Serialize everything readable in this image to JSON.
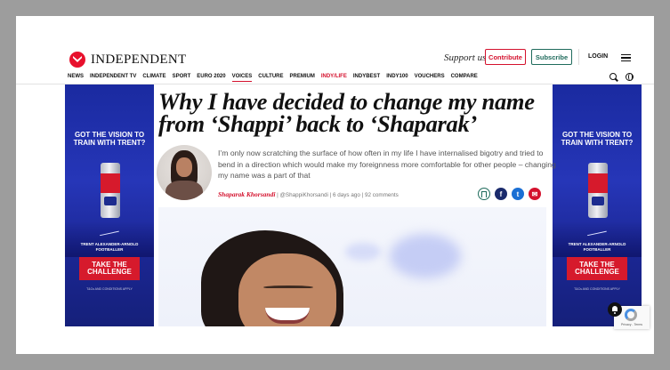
{
  "header": {
    "logo_text": "INDEPENDENT",
    "support_text": "Support us",
    "contribute_label": "Contribute",
    "subscribe_label": "Subscribe",
    "login_label": "LOGIN"
  },
  "nav": {
    "items": [
      "NEWS",
      "INDEPENDENT TV",
      "CLIMATE",
      "SPORT",
      "EURO 2020",
      "VOICES",
      "CULTURE",
      "PREMIUM",
      "INDY/LIFE",
      "INDYBEST",
      "INDY100",
      "VOUCHERS",
      "COMPARE"
    ],
    "active": "VOICES"
  },
  "ad": {
    "headline": "GOT THE VISION TO TRAIN WITH TRENT?",
    "can_brand": "Red Bull",
    "player_name": "TRENT ALEXANDER-ARNOLD FOOTBALLER",
    "cta": "TAKE THE CHALLENGE",
    "terms": "T&Cs AND CONDITIONS APPLY"
  },
  "article": {
    "headline": "Why I have decided to change my name from ‘Shappi’ back to ‘Shaparak’",
    "standfirst": "I’m only now scratching the surface of how often in my life I have internalised bigotry and tried to bend in a direction which would make my foreignness more comfortable for other people – changing my name was a part of that",
    "author": "Shaparak Khorsandi",
    "byline_rest": " | @ShappiKhorsandi | 6 days ago | 92 comments"
  },
  "recaptcha": {
    "text": "Privacy - Terms"
  },
  "colors": {
    "brand_red": "#d4112d",
    "brand_green": "#1f6b5c",
    "ad_blue": "#2636b8"
  }
}
